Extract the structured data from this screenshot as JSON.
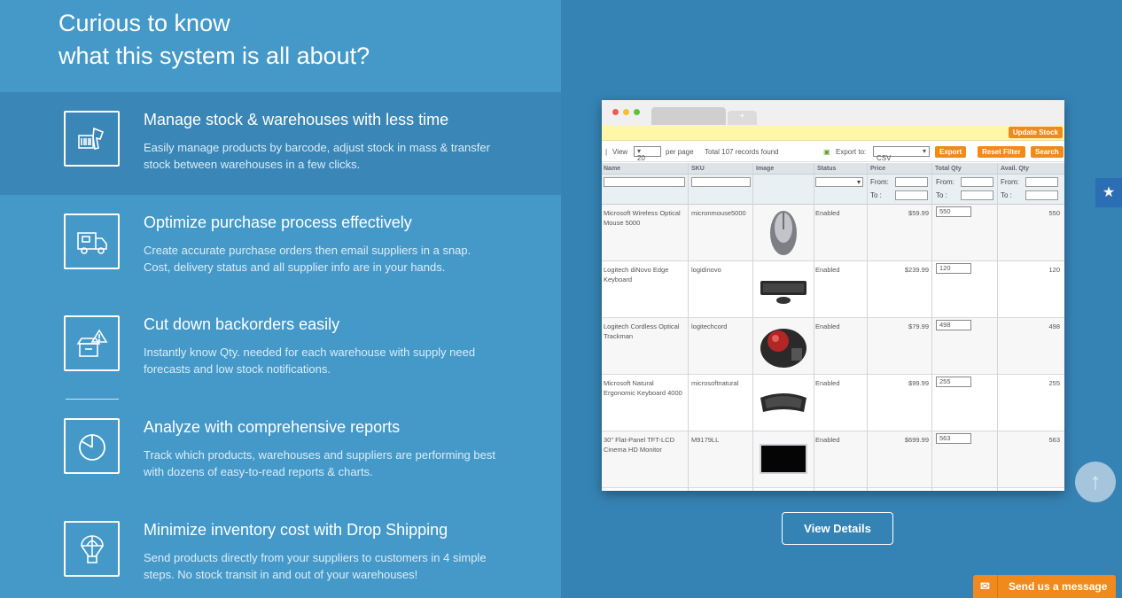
{
  "headline": {
    "line1": "Curious to know",
    "line2": "what this system is all about?"
  },
  "features": [
    {
      "title": "Manage stock & warehouses with less time",
      "desc": "Easily manage products by barcode, adjust stock in mass & transfer stock between warehouses in a few clicks.",
      "icon": "barcode-scanner-icon"
    },
    {
      "title": "Optimize purchase process effectively",
      "desc": "Create accurate purchase orders then email suppliers in a snap. Cost, delivery status and all supplier info are in your hands.",
      "icon": "delivery-truck-icon"
    },
    {
      "title": "Cut down backorders easily",
      "desc": "Instantly know Qty. needed for each warehouse with supply need forecasts and low stock notifications.",
      "icon": "box-warning-icon"
    },
    {
      "title": "Analyze with comprehensive reports",
      "desc": "Track which products, warehouses and suppliers are performing best with dozens of easy-to-read reports & charts.",
      "icon": "pie-chart-icon"
    },
    {
      "title": "Minimize inventory cost with Drop Shipping",
      "desc": "Send products directly from your suppliers to customers in 4 simple steps. No stock transit in and out of your warehouses!",
      "icon": "parachute-box-icon"
    }
  ],
  "mock": {
    "update_stock": "Update Stock",
    "view_label": "View",
    "view_value": "20",
    "per_page": "per page",
    "total": "Total 107 records found",
    "export_to": "Export to:",
    "export_value": "CSV",
    "export_btn": "Export",
    "reset_btn": "Reset Filter",
    "search_btn": "Search",
    "columns": [
      "Name",
      "SKU",
      "Image",
      "Status",
      "Price",
      "Total Qty",
      "Avail. Qty"
    ],
    "from_label": "From:",
    "to_label": "To :",
    "rows": [
      {
        "name": "Microsoft Wireless Optical Mouse 5000",
        "sku": "micronmouse5000",
        "status": "Enabled",
        "price": "$59.99",
        "qty": "550",
        "avail": "550",
        "img": "mouse"
      },
      {
        "name": "Logitech diNovo Edge Keyboard",
        "sku": "logidinovo",
        "status": "Enabled",
        "price": "$239.99",
        "qty": "120",
        "avail": "120",
        "img": "keyboard"
      },
      {
        "name": "Logitech Cordless Optical Trackman",
        "sku": "logitechcord",
        "status": "Enabled",
        "price": "$79.99",
        "qty": "498",
        "avail": "498",
        "img": "trackball"
      },
      {
        "name": "Microsoft Natural Ergonomic Keyboard 4000",
        "sku": "microsoftnatural",
        "status": "Enabled",
        "price": "$99.99",
        "qty": "255",
        "avail": "255",
        "img": "ergokeyboard"
      },
      {
        "name": "30\" Flat-Panel TFT-LCD Cinema HD Monitor",
        "sku": "M9179LL",
        "status": "Enabled",
        "price": "$699.99",
        "qty": "563",
        "avail": "563",
        "img": "monitor"
      }
    ]
  },
  "view_details": "View Details",
  "send_message": "Send us a message",
  "colors": {
    "accent": "#f08a1d",
    "left_bg": "#4599c9",
    "right_bg": "#3583b4"
  }
}
